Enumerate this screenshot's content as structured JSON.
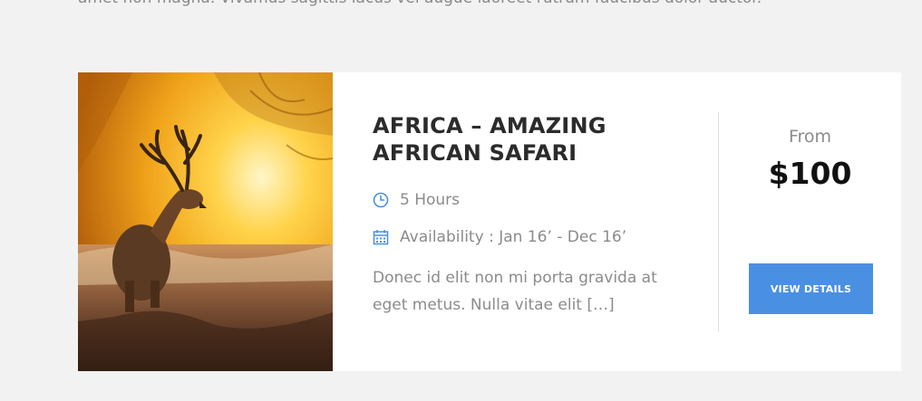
{
  "intro": {
    "text": "amet non magna. Vivamus sagittis lacus vel augue laoreet rutrum faucibus dolor auctor."
  },
  "tour": {
    "title_line1": "AFRICA – AMAZING",
    "title_line2": "AFRICAN SAFARI",
    "duration": "5 Hours",
    "availability": "Availability : Jan 16’ - Dec 16’",
    "excerpt_line1": "Donec id elit non mi porta gravida at",
    "excerpt_line2": "eget metus. Nulla vitae elit […]",
    "from_label": "From",
    "price": "$100",
    "button_label": "VIEW DETAILS"
  },
  "icons": {
    "duration": "clock-icon",
    "availability": "calendar-icon"
  },
  "colors": {
    "accent": "#4a90e2",
    "title": "#2b2b2b",
    "muted": "#8b8b8b",
    "background": "#f2f2f2"
  }
}
